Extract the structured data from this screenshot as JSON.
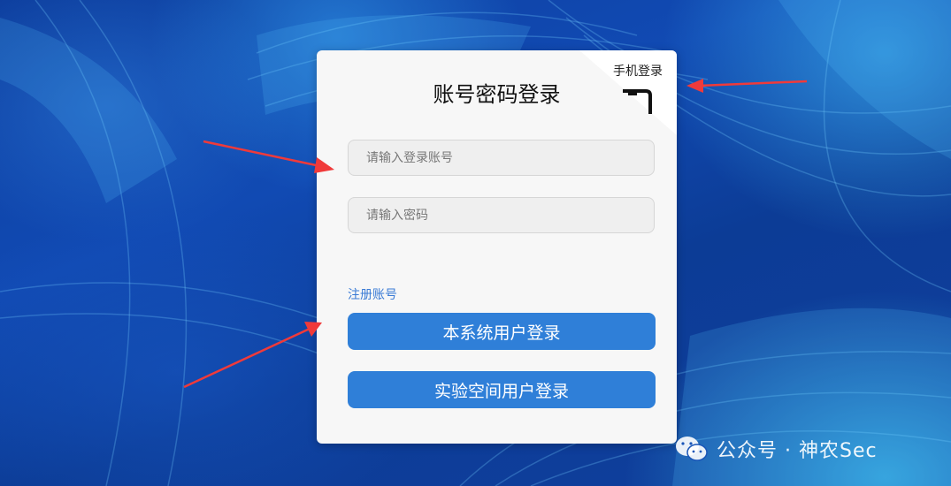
{
  "login": {
    "title": "账号密码登录",
    "mobile_login_label": "手机登录",
    "account_placeholder": "请输入登录账号",
    "password_placeholder": "请输入密码",
    "register_link": "注册账号",
    "system_login_button": "本系统用户登录",
    "lab_login_button": "实验空间用户登录"
  },
  "watermark": {
    "text": "公众号 · 神农Sec",
    "icon": "wechat-icon"
  },
  "colors": {
    "primary_button": "#2f7fd8",
    "link": "#3a7bd5",
    "annotation_arrow": "#f03a3a",
    "background": "#114ab3"
  }
}
